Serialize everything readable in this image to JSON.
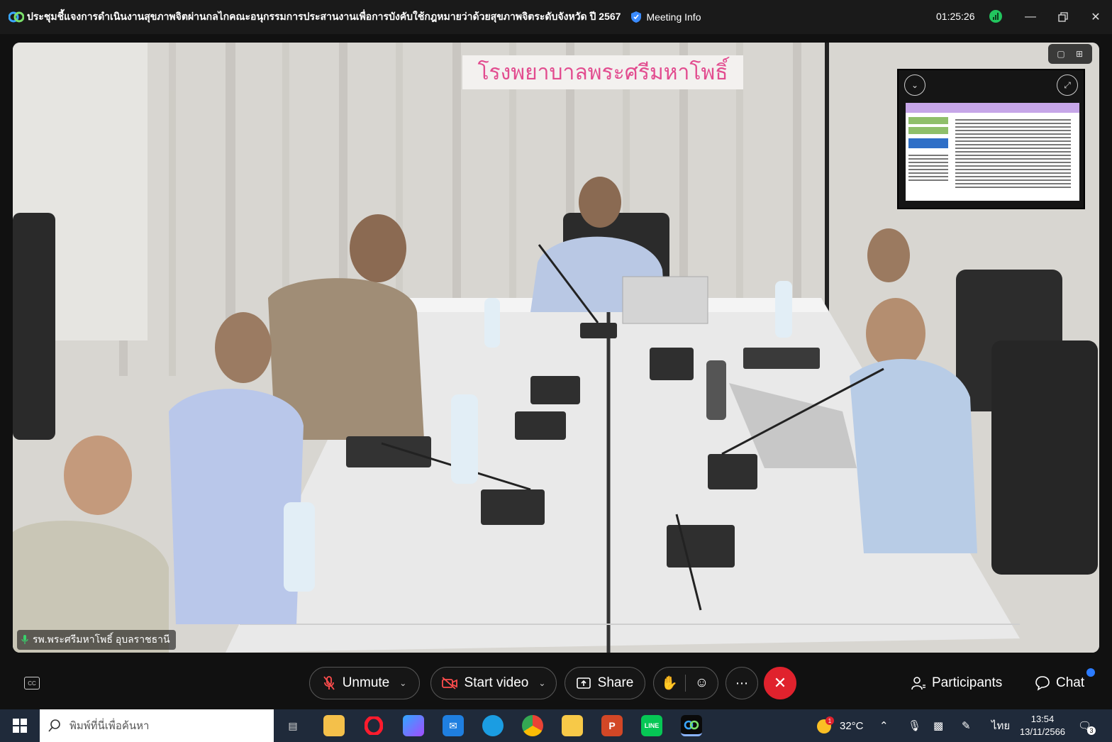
{
  "window": {
    "title": "ประชุมชี้แจงการดำเนินงานสุขภาพจิตผ่านกลไกคณะอนุกรรมการประสานงานเพื่อการบังคับใช้กฎหมายว่าด้วยสุขภาพจิตระดับจังหวัด ปี 2567",
    "meeting_info_label": "Meeting Info",
    "timer": "01:25:26"
  },
  "video": {
    "speaker_name": "รพ.พระศรีมหาโพธิ์ อุบลราชธานี",
    "banner_text": "โรงพยาบาลพระศรีมหาโพธิ์"
  },
  "controls": {
    "unmute_label": "Unmute",
    "start_video_label": "Start video",
    "share_label": "Share",
    "participants_label": "Participants",
    "chat_label": "Chat",
    "cc_label": "CC"
  },
  "taskbar": {
    "search_placeholder": "พิมพ์ที่นี่เพื่อค้นหา",
    "weather": "32°C",
    "language": "ไทย",
    "time": "13:54",
    "date": "13/11/2566",
    "notification_count": "3",
    "weather_badge": "1"
  },
  "colors": {
    "end_call": "#e0222d",
    "accent_blue": "#2b7bff",
    "signal_green": "#22c55e",
    "taskbar_bg": "#1f2a3a"
  }
}
